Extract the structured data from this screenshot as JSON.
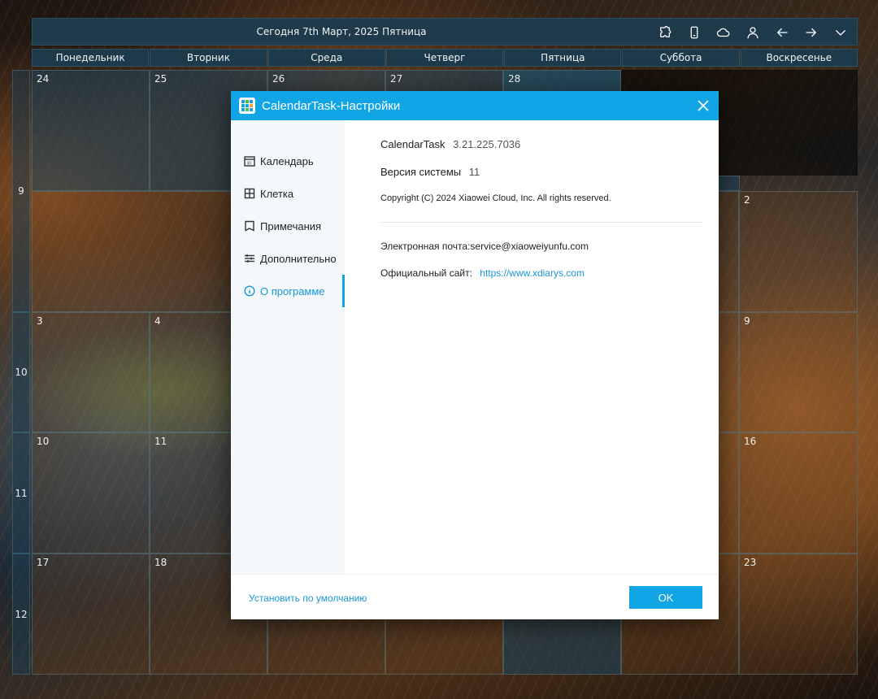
{
  "header": {
    "today_text": "Сегодня 7th Март, 2025 Пятница",
    "icons": [
      "puzzle-icon",
      "phone-icon",
      "cloud-icon",
      "user-icon",
      "arrow-left-icon",
      "arrow-right-icon",
      "chevron-down-icon"
    ]
  },
  "weekdays": [
    "Понедельник",
    "Вторник",
    "Среда",
    "Четверг",
    "Пятница",
    "Суббота",
    "Воскресенье"
  ],
  "week_numbers": [
    "9",
    "10",
    "11",
    "12"
  ],
  "calendar": {
    "rows": [
      [
        "24",
        "25",
        "26",
        "27",
        "28",
        "",
        "2"
      ],
      [
        "3",
        "4",
        "",
        "",
        "",
        "",
        "9"
      ],
      [
        "10",
        "11",
        "",
        "",
        "",
        "",
        "16"
      ],
      [
        "17",
        "18",
        "",
        "",
        "",
        "",
        "23"
      ]
    ]
  },
  "dialog": {
    "title": "CalendarTask-Настройки",
    "nav": [
      {
        "label": "Календарь",
        "icon": "calendar-icon"
      },
      {
        "label": "Клетка",
        "icon": "grid-icon"
      },
      {
        "label": "Примечания",
        "icon": "note-icon"
      },
      {
        "label": "Дополнительно",
        "icon": "sliders-icon"
      },
      {
        "label": "О программе",
        "icon": "info-icon",
        "active": true
      }
    ],
    "about": {
      "app_name": "CalendarTask",
      "app_version": "3.21.225.7036",
      "system_label": "Версия системы",
      "system_version": "11",
      "copyright": "Copyright (C) 2024 Xiaowei Cloud, Inc. All rights reserved.",
      "email": "Электронная почта:service@xiaoweiyunfu.com",
      "site_label": "Официальный сайт:",
      "site_url": "https://www.xdiarys.com"
    },
    "reset_label": "Установить по умолчанию",
    "ok_label": "OK"
  },
  "colors": {
    "accent": "#12a5e6",
    "header_bg": "#1f3a4a",
    "cell_current": "#19465f"
  }
}
